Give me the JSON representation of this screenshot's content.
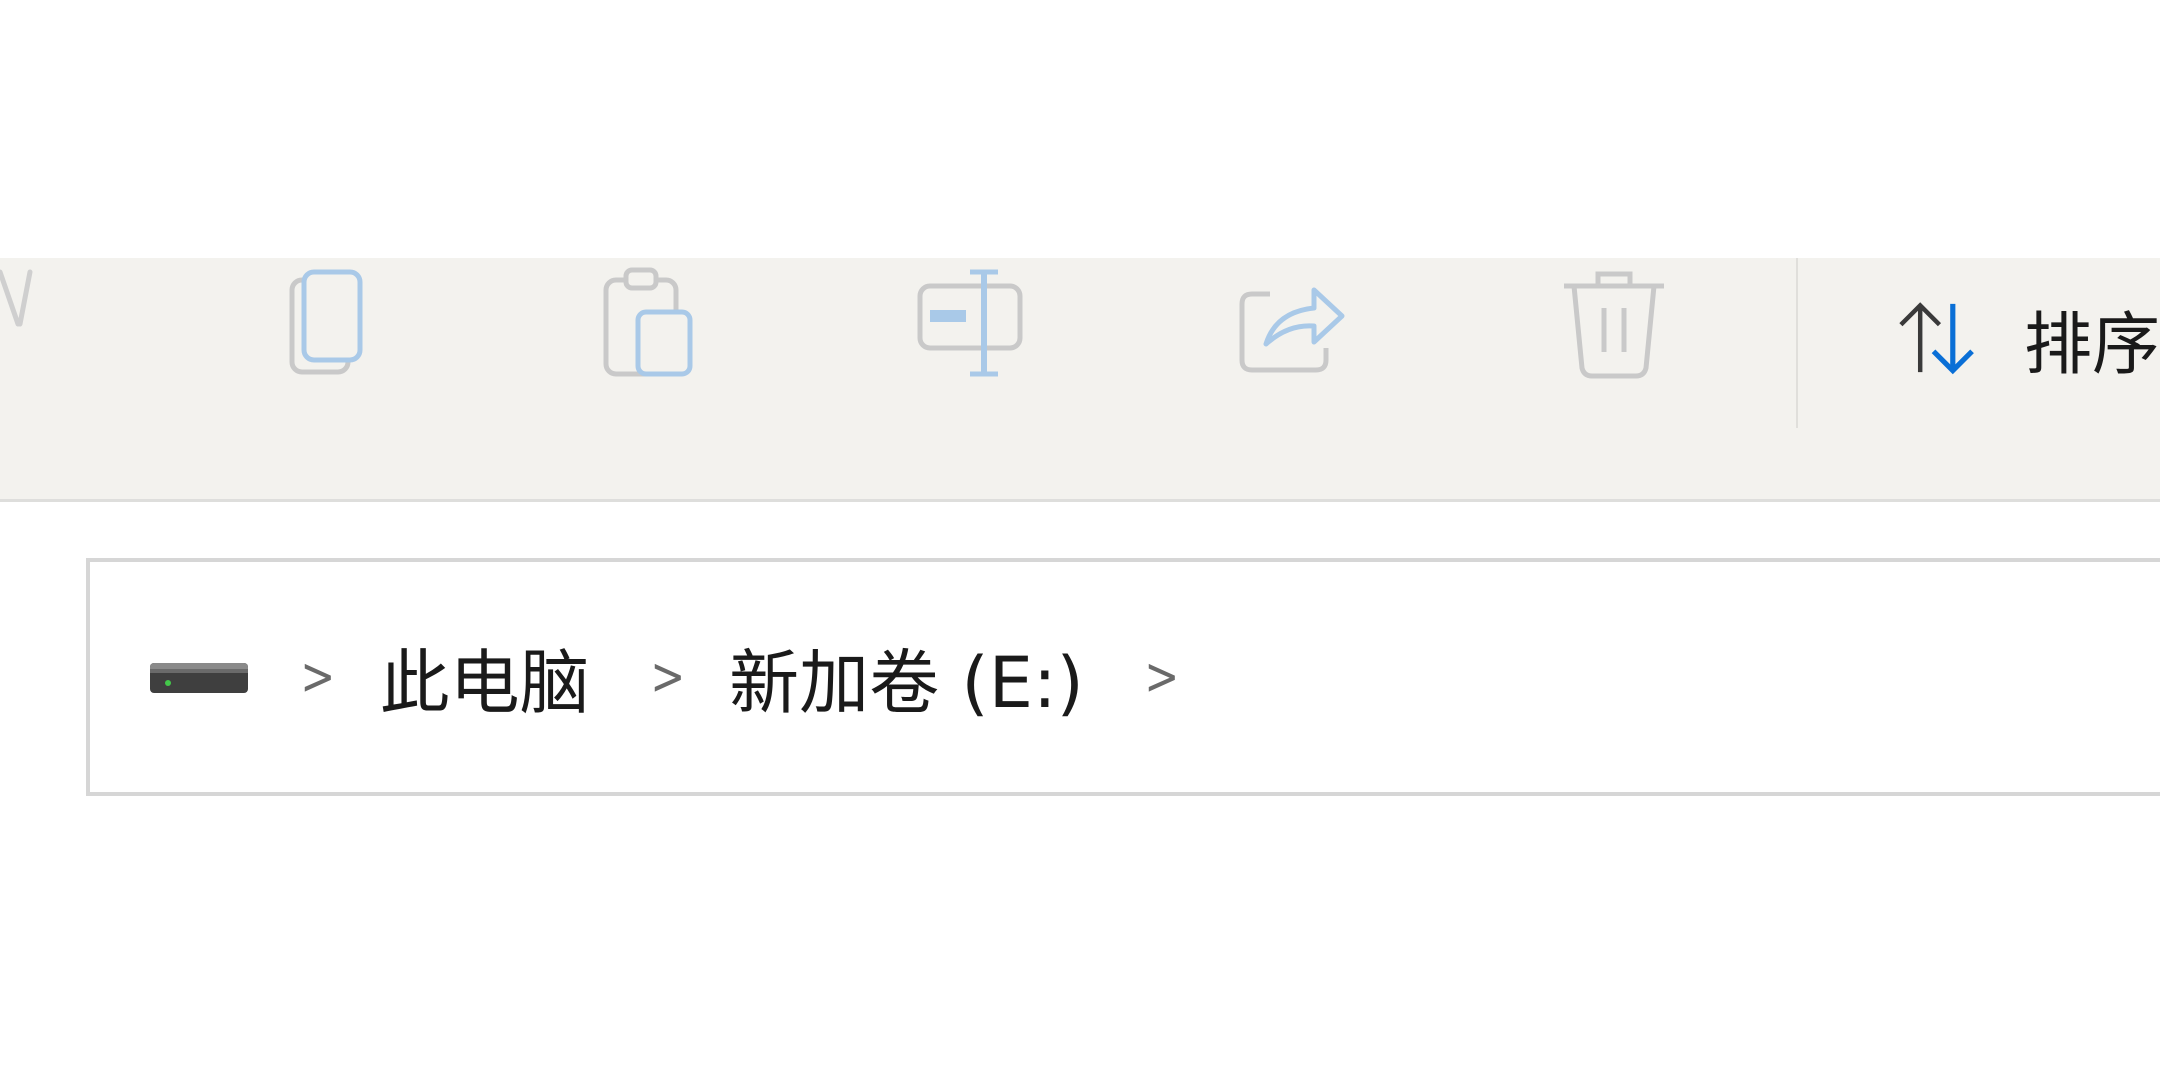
{
  "toolbar": {
    "buttons": [
      {
        "icon": "cut-icon",
        "enabled": false
      },
      {
        "icon": "copy-icon",
        "enabled": false
      },
      {
        "icon": "paste-icon",
        "enabled": false
      },
      {
        "icon": "rename-icon",
        "enabled": false
      },
      {
        "icon": "share-icon",
        "enabled": false
      },
      {
        "icon": "delete-icon",
        "enabled": false
      }
    ],
    "sort": {
      "icon": "sort-arrows-icon",
      "label": "排序"
    }
  },
  "address_bar": {
    "root_icon": "drive-icon",
    "crumbs": [
      "此电脑",
      "新加卷 (E:)"
    ]
  },
  "colors": {
    "toolbar_bg": "#f3f2ee",
    "disabled_icon": "#c8c8c8",
    "accent": "#0a6fd6"
  }
}
